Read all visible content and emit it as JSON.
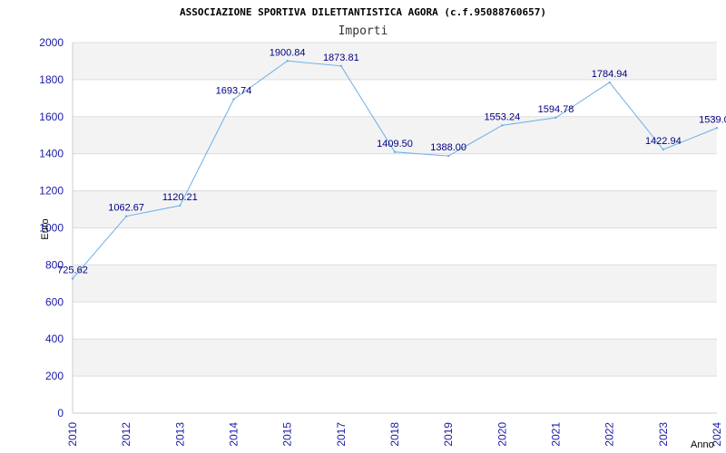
{
  "chart_data": {
    "type": "line",
    "title": "ASSOCIAZIONE SPORTIVA DILETTANTISTICA AGORA (c.f.95088760657)",
    "subtitle": "Importi",
    "xlabel": "Anno",
    "ylabel": "Euro",
    "ylim": [
      0,
      2000
    ],
    "yticks": [
      0,
      200,
      400,
      600,
      800,
      1000,
      1200,
      1400,
      1600,
      1800,
      2000
    ],
    "grid": true,
    "categories": [
      "2010",
      "2012",
      "2013",
      "2014",
      "2015",
      "2017",
      "2018",
      "2019",
      "2020",
      "2021",
      "2022",
      "2023",
      "2024"
    ],
    "series": [
      {
        "values": [
          725.62,
          1062.67,
          1120.21,
          1693.74,
          1900.84,
          1873.81,
          1409.5,
          1388.0,
          1553.24,
          1594.78,
          1784.94,
          1422.94,
          1539.0
        ],
        "labels": [
          "725.62",
          "1062.67",
          "1120.21",
          "1693.74",
          "1900.84",
          "1873.81",
          "1409.50",
          "1388.00",
          "1553.24",
          "1594.78",
          "1784.94",
          "1422.94",
          "1539.00"
        ]
      }
    ],
    "colors": {
      "line": "#6aaee8",
      "band": "#f3f3f3",
      "gridline": "#dddddd",
      "tick": "#1a1aa6",
      "label": "#000080"
    }
  }
}
